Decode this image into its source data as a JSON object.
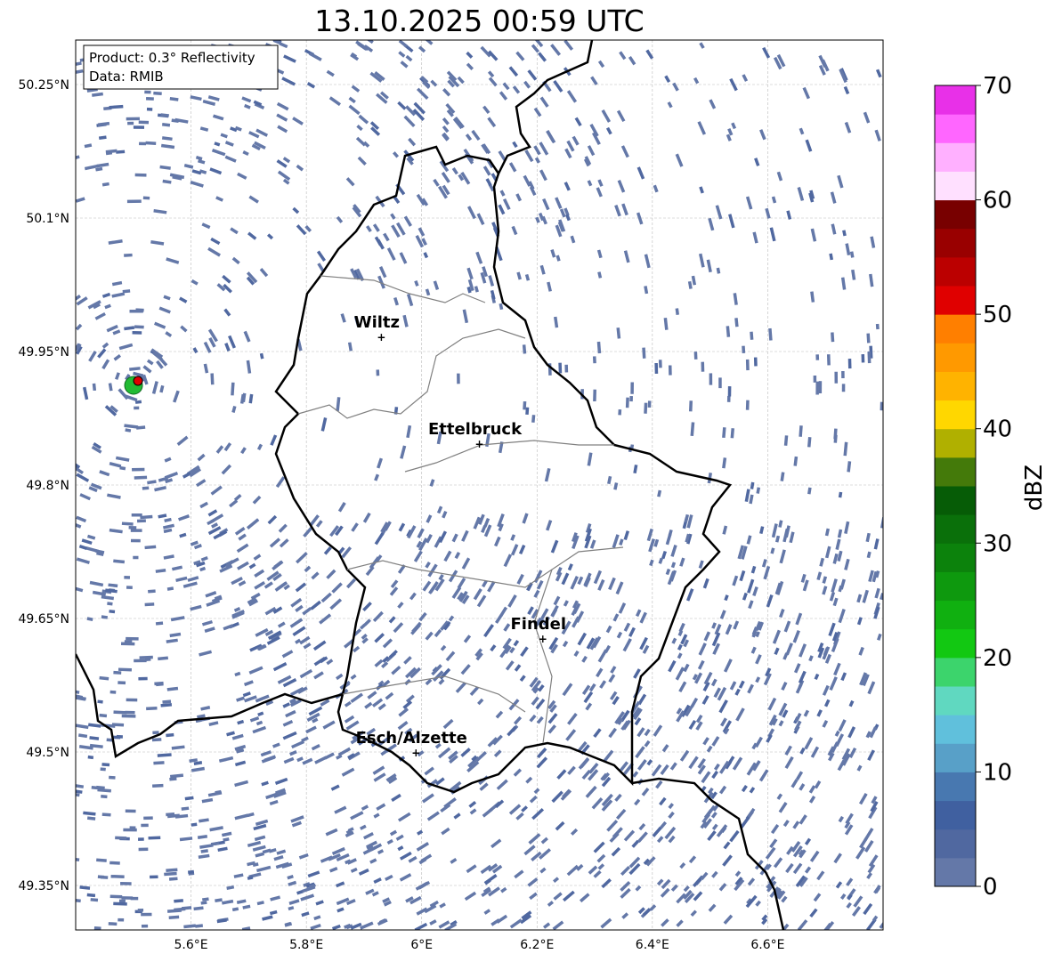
{
  "title": "13.10.2025 00:59 UTC",
  "info": {
    "product": "Product: 0.3° Reflectivity",
    "data": "Data: RMIB"
  },
  "map": {
    "lon_range": [
      5.4,
      6.8
    ],
    "lat_range": [
      49.3,
      50.3
    ],
    "lon_ticks": [
      {
        "v": 5.6,
        "l": "5.6°E"
      },
      {
        "v": 5.8,
        "l": "5.8°E"
      },
      {
        "v": 6.0,
        "l": "6°E"
      },
      {
        "v": 6.2,
        "l": "6.2°E"
      },
      {
        "v": 6.4,
        "l": "6.4°E"
      },
      {
        "v": 6.6,
        "l": "6.6°E"
      }
    ],
    "lat_ticks": [
      {
        "v": 50.25,
        "l": "50.25°N"
      },
      {
        "v": 50.1,
        "l": "50.1°N"
      },
      {
        "v": 49.95,
        "l": "49.95°N"
      },
      {
        "v": 49.8,
        "l": "49.8°N"
      },
      {
        "v": 49.65,
        "l": "49.65°N"
      },
      {
        "v": 49.5,
        "l": "49.5°N"
      },
      {
        "v": 49.35,
        "l": "49.35°N"
      }
    ],
    "cities": [
      {
        "name": "Wiltz",
        "lon": 5.93,
        "lat": 49.967
      },
      {
        "name": "Ettelbruck",
        "lon": 6.1,
        "lat": 49.847
      },
      {
        "name": "Findel",
        "lon": 6.21,
        "lat": 49.628
      },
      {
        "name": "Esch/Alzette",
        "lon": 5.99,
        "lat": 49.5
      }
    ],
    "radar_site": {
      "lon": 5.505,
      "lat": 49.915
    }
  },
  "colorbar": {
    "label": "dBZ",
    "min": 0,
    "max": 70,
    "ticks": [
      "0",
      "10",
      "20",
      "30",
      "40",
      "50",
      "60",
      "70"
    ],
    "colors": [
      "#6478a8",
      "#5068a0",
      "#4060a0",
      "#4878b0",
      "#58a0c8",
      "#60c0dc",
      "#60d8c0",
      "#3cd46c",
      "#12c812",
      "#10b010",
      "#0e990e",
      "#0c820c",
      "#0a700a",
      "#065c06",
      "#447a0a",
      "#b0b000",
      "#ffd700",
      "#ffb300",
      "#ff9900",
      "#ff7f00",
      "#e00000",
      "#bb0000",
      "#990000",
      "#780000",
      "#ffe0ff",
      "#ffb0ff",
      "#ff66ff",
      "#e830e8"
    ]
  }
}
